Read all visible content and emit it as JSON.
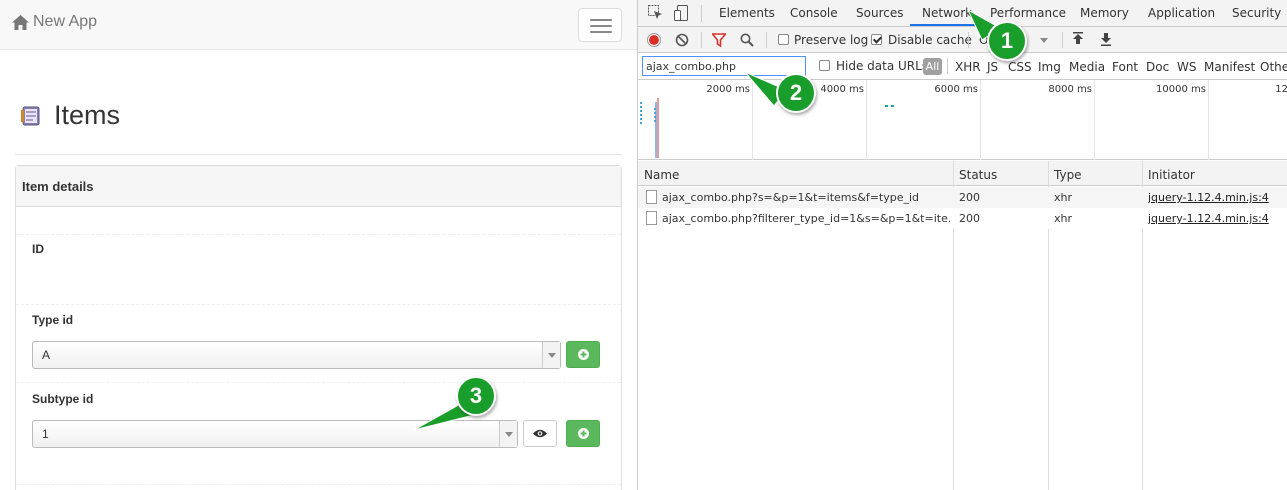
{
  "app": {
    "brand": "New App",
    "page_title": "Items",
    "panel_heading": "Item details",
    "fields": {
      "id_label": "ID",
      "type_label": "Type id",
      "type_value": "A",
      "subtype_label": "Subtype id",
      "subtype_value": "1"
    }
  },
  "devtools": {
    "tabs": [
      "Elements",
      "Console",
      "Sources",
      "Network",
      "Performance",
      "Memory",
      "Application",
      "Security"
    ],
    "active_tab": "Network",
    "toolbar": {
      "preserve_log": "Preserve log",
      "disable_cache": "Disable cache",
      "throttle_partial": "O"
    },
    "filter": {
      "value": "ajax_combo.php",
      "hide_data_urls": "Hide data URLs",
      "all": "All",
      "types": [
        "XHR",
        "JS",
        "CSS",
        "Img",
        "Media",
        "Font",
        "Doc",
        "WS",
        "Manifest",
        "Othe"
      ]
    },
    "timeline_ticks": [
      "2000 ms",
      "4000 ms",
      "6000 ms",
      "8000 ms",
      "10000 ms",
      "12"
    ],
    "columns": [
      "Name",
      "Status",
      "Type",
      "Initiator"
    ],
    "requests": [
      {
        "name": "ajax_combo.php?s=&p=1&t=items&f=type_id",
        "status": "200",
        "type": "xhr",
        "initiator": "jquery-1.12.4.min.js:4"
      },
      {
        "name": "ajax_combo.php?filterer_type_id=1&s=&p=1&t=ite…",
        "status": "200",
        "type": "xhr",
        "initiator": "jquery-1.12.4.min.js:4"
      }
    ]
  },
  "annotations": [
    "1",
    "2",
    "3"
  ],
  "colors": {
    "badge_green": "#1a9e2b",
    "button_green": "#5cb85c",
    "active_tab_blue": "#1a73e8",
    "record_red": "#d93025"
  }
}
